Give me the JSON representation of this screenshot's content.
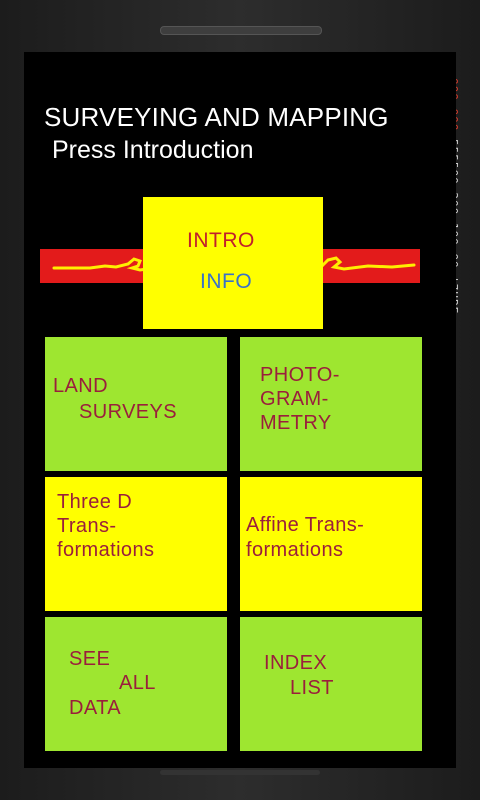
{
  "header": {
    "title": "SURVEYING AND MAPPING",
    "subtitle": "Press Introduction"
  },
  "intro_box": {
    "line1": "INTRO",
    "line2": "INFO"
  },
  "tiles": [
    {
      "lines": [
        "LAND",
        "SURVEYS"
      ]
    },
    {
      "lines": [
        "PHOTO-",
        "GRAM-",
        "METRY"
      ]
    },
    {
      "lines": [
        "Three D",
        "Trans-",
        "formations"
      ]
    },
    {
      "lines": [
        "Affine Trans-",
        "formations"
      ]
    },
    {
      "lines": [
        "SEE",
        "ALL",
        "DATA"
      ]
    },
    {
      "lines": [
        "INDEX",
        "LIST"
      ]
    }
  ],
  "side_readout": {
    "red_part": "000 000",
    "rest": " 555500 200 100 00.'7HBE"
  },
  "colors": {
    "tile_green": "#9ee630",
    "tile_yellow": "#ffff00",
    "label_red": "#9a1f3c",
    "banner_red": "#e31b1b",
    "info_blue": "#3a72c8"
  }
}
